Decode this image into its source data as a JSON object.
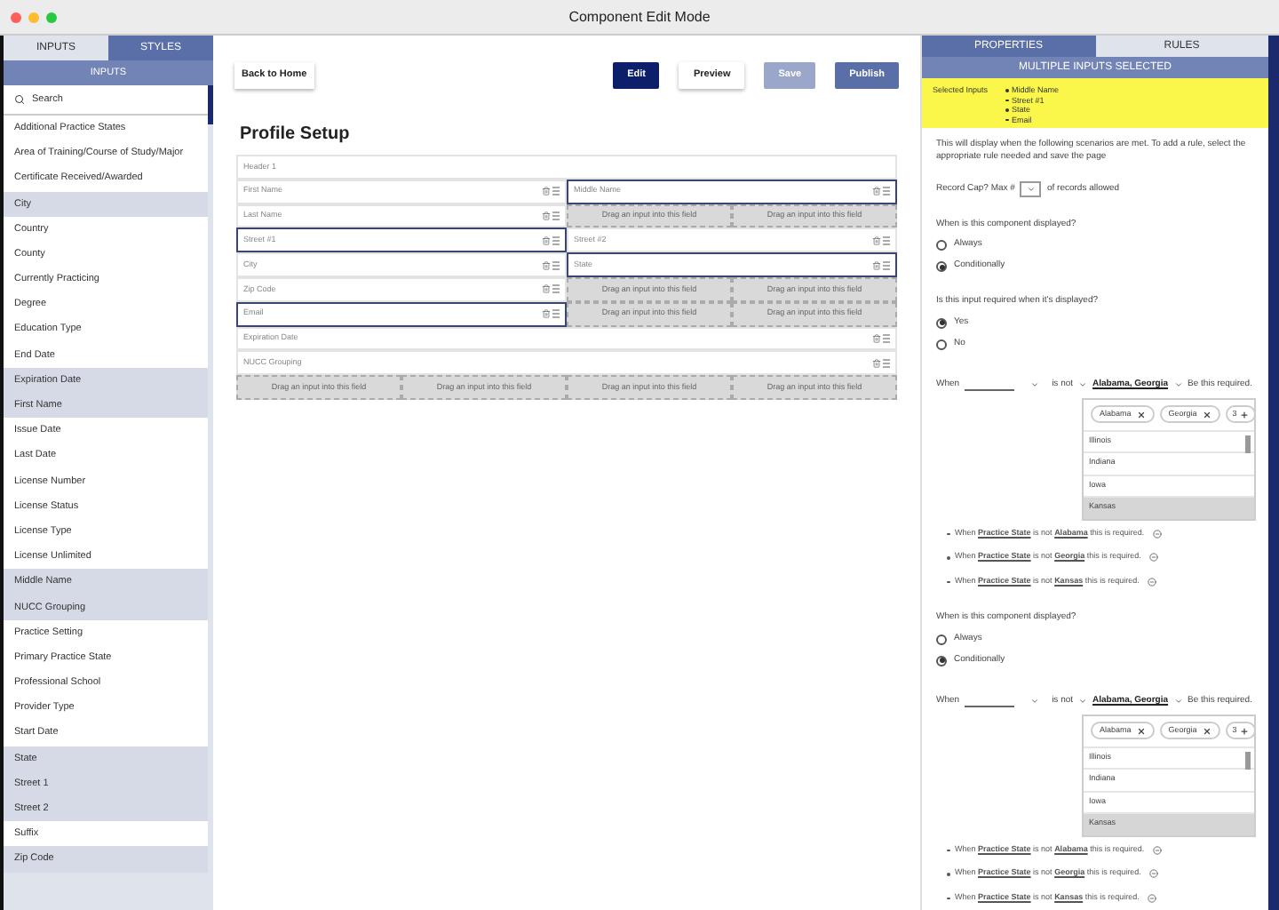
{
  "window": {
    "title": "Component Edit Mode"
  },
  "left": {
    "tabs": [
      {
        "label": "INPUTS",
        "selected": false
      },
      {
        "label": "STYLES",
        "selected": true
      }
    ],
    "header": "INPUTS",
    "search": {
      "placeholder": "Search"
    },
    "items": [
      {
        "label": "Additional Practice States",
        "in_form": false
      },
      {
        "label": "Area of Training/Course of Study/Major",
        "in_form": false
      },
      {
        "label": "Certificate Received/Awarded",
        "in_form": false
      },
      {
        "label": "City",
        "in_form": true
      },
      {
        "label": "Country",
        "in_form": false
      },
      {
        "label": "County",
        "in_form": false
      },
      {
        "label": "Currently Practicing",
        "in_form": false
      },
      {
        "label": "Degree",
        "in_form": false
      },
      {
        "label": "Education Type",
        "in_form": false
      },
      {
        "label": "End Date",
        "in_form": false
      },
      {
        "label": "Expiration Date",
        "in_form": true
      },
      {
        "label": "First Name",
        "in_form": true
      },
      {
        "label": "Issue Date",
        "in_form": false
      },
      {
        "label": "Last Date",
        "in_form": false
      },
      {
        "label": "License Number",
        "in_form": false
      },
      {
        "label": "License Status",
        "in_form": false
      },
      {
        "label": "License Type",
        "in_form": false
      },
      {
        "label": "License Unlimited",
        "in_form": false
      },
      {
        "label": "Middle Name",
        "in_form": true
      },
      {
        "label": "NUCC Grouping",
        "in_form": true
      },
      {
        "label": "Practice Setting",
        "in_form": false
      },
      {
        "label": "Primary Practice State",
        "in_form": false
      },
      {
        "label": "Professional School",
        "in_form": false
      },
      {
        "label": "Provider Type",
        "in_form": false
      },
      {
        "label": "Start Date",
        "in_form": false
      },
      {
        "label": "State",
        "in_form": true
      },
      {
        "label": "Street 1",
        "in_form": true
      },
      {
        "label": "Street 2",
        "in_form": true
      },
      {
        "label": "Suffix",
        "in_form": false
      },
      {
        "label": "Zip Code",
        "in_form": true
      }
    ]
  },
  "toolbar": {
    "back": "Back to Home",
    "buttons": [
      {
        "label": "Edit",
        "kind": "primary",
        "disabled": false
      },
      {
        "label": "Preview",
        "kind": "outline",
        "disabled": false
      },
      {
        "label": "Save",
        "kind": "secondary",
        "disabled": true
      },
      {
        "label": "Publish",
        "kind": "secondary",
        "disabled": false
      }
    ]
  },
  "form": {
    "title": "Profile Setup",
    "rows": [
      [
        {
          "kind": "header",
          "label": "Header 1",
          "selected": false
        }
      ],
      [
        {
          "kind": "input",
          "label": "First Name",
          "selected": false
        },
        {
          "kind": "input",
          "label": "Middle Name",
          "selected": true
        }
      ],
      [
        {
          "kind": "input",
          "label": "Last Name",
          "selected": false
        },
        {
          "kind": "drop",
          "label": "Drag an input into this field"
        },
        {
          "kind": "drop",
          "label": "Drag an input into this field"
        }
      ],
      [
        {
          "kind": "input",
          "label": "Street #1",
          "selected": true
        },
        {
          "kind": "input",
          "label": "Street #2",
          "selected": false
        }
      ],
      [
        {
          "kind": "input",
          "label": "City",
          "selected": false
        },
        {
          "kind": "input",
          "label": "State",
          "selected": true
        }
      ],
      [
        {
          "kind": "input",
          "label": "Zip Code",
          "selected": false
        },
        {
          "kind": "drop",
          "label": "Drag an input into this field"
        },
        {
          "kind": "drop",
          "label": "Drag an input into this field"
        }
      ],
      [
        {
          "kind": "input",
          "label": "Email",
          "selected": true
        },
        {
          "kind": "drop",
          "label": "Drag an input into this field"
        },
        {
          "kind": "drop",
          "label": "Drag an input into this field"
        }
      ],
      [
        {
          "kind": "input",
          "label": "Expiration Date",
          "selected": false
        }
      ],
      [
        {
          "kind": "input",
          "label": "NUCC Grouping",
          "selected": false
        }
      ],
      [
        {
          "kind": "drop",
          "label": "Drag an input into this field"
        },
        {
          "kind": "drop",
          "label": "Drag an input into this field"
        },
        {
          "kind": "drop",
          "label": "Drag an input into this field"
        },
        {
          "kind": "drop",
          "label": "Drag an input into this field"
        }
      ]
    ]
  },
  "right": {
    "tabs": [
      {
        "label": "PROPERTIES",
        "selected": true
      },
      {
        "label": "RULES",
        "selected": false
      }
    ],
    "header": "MULTIPLE INPUTS SELECTED",
    "selected_inputs": {
      "label": "Selected Inputs",
      "items": [
        "Middle Name",
        "Street #1",
        "State",
        "Email"
      ]
    },
    "content": [
      {
        "kind": "note",
        "text": "This will display when the following scenarios are met. To add a rule, select the appropriate rule needed and save the page"
      },
      {
        "kind": "record_cap",
        "label": "Record Cap? Max #",
        "suffix": "of records allowed"
      },
      {
        "kind": "radio_group",
        "question": "When is this component displayed?",
        "options": [
          {
            "label": "Always",
            "selected": false
          },
          {
            "label": "Conditionally",
            "selected": true
          }
        ]
      },
      {
        "kind": "radio_group",
        "question": "Is this input required when it's displayed?",
        "options": [
          {
            "label": "Yes",
            "selected": true
          },
          {
            "label": "No",
            "selected": false
          }
        ]
      },
      {
        "kind": "when_rule",
        "label": "When",
        "operator": "is not",
        "value": "Alabama, Georgia",
        "suffix": "Be this required."
      },
      {
        "kind": "multiselect",
        "chips": [
          "Alabama",
          "Georgia"
        ],
        "more": "3",
        "options": [
          {
            "label": "Illinois",
            "selected": false
          },
          {
            "label": "Indiana",
            "selected": false
          },
          {
            "label": "Iowa",
            "selected": false
          },
          {
            "label": "Kansas",
            "selected": true
          }
        ]
      },
      {
        "kind": "rule_list",
        "rules": [
          "When **Practice State** is not **Alabama** this is required.",
          "When **Practice State** is not **Georgia** this is required.",
          "When **Practice State** is not **Kansas** this is required."
        ]
      },
      {
        "kind": "radio_group",
        "question": "When is this component displayed?",
        "options": [
          {
            "label": "Always",
            "selected": false
          },
          {
            "label": "Conditionally",
            "selected": true
          }
        ]
      },
      {
        "kind": "when_rule",
        "label": "When",
        "operator": "is not",
        "value": "Alabama, Georgia",
        "suffix": "Be this required."
      },
      {
        "kind": "multiselect",
        "chips": [
          "Alabama",
          "Georgia"
        ],
        "more": "3",
        "options": [
          {
            "label": "Illinois",
            "selected": false
          },
          {
            "label": "Indiana",
            "selected": false
          },
          {
            "label": "Iowa",
            "selected": false
          },
          {
            "label": "Kansas",
            "selected": true
          }
        ]
      },
      {
        "kind": "rule_list",
        "rules": [
          "When **Practice State** is not **Alabama** this is required.",
          "When **Practice State** is not **Georgia** this is required.",
          "When **Practice State** is not **Kansas** this is required."
        ]
      }
    ]
  }
}
